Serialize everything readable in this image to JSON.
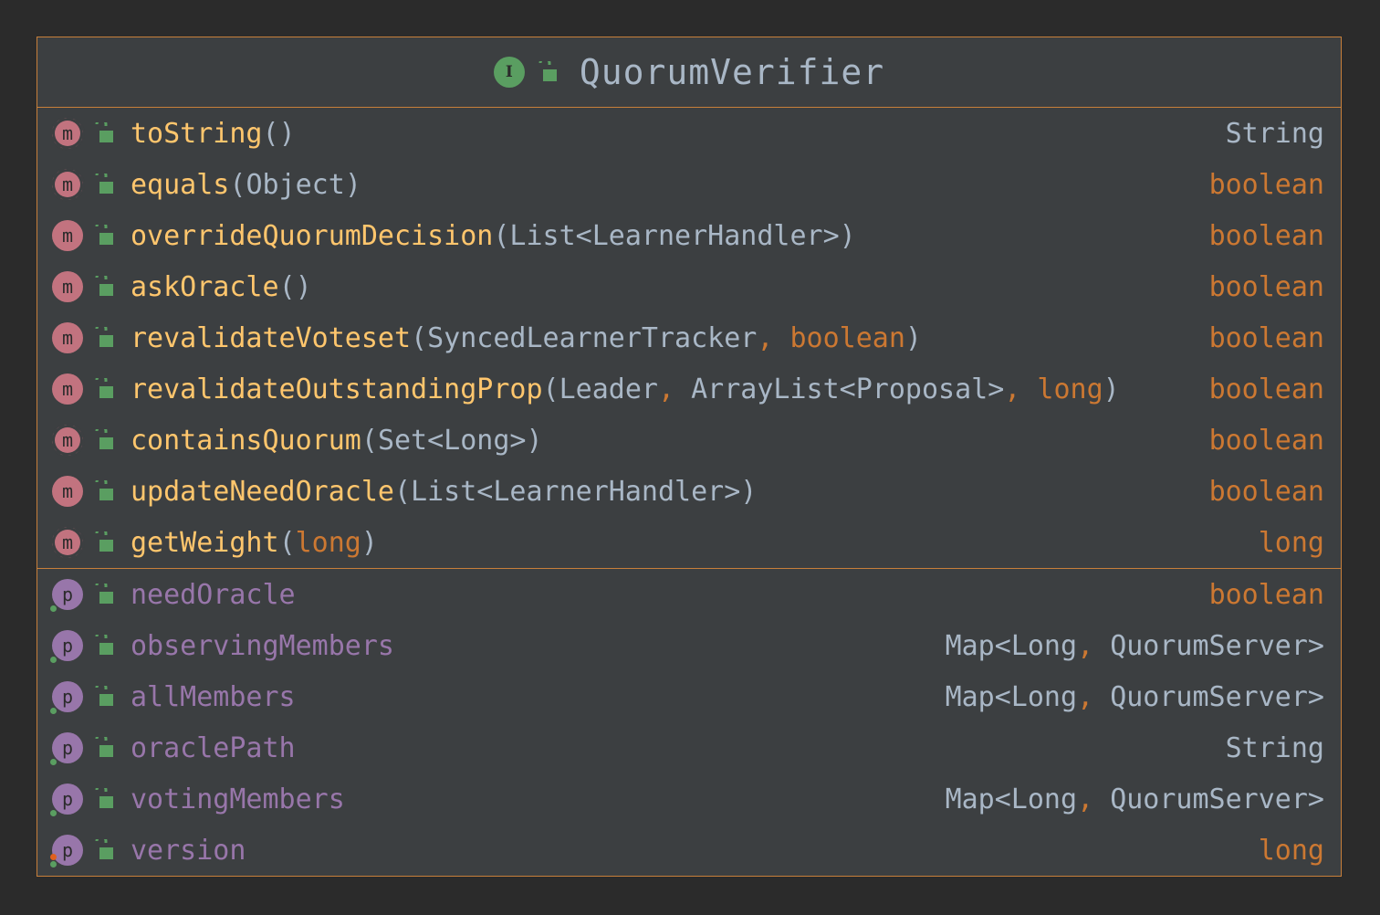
{
  "diagram": {
    "title": "QuorumVerifier",
    "kind_badge": "I",
    "methods": [
      {
        "name": "toString",
        "params": [],
        "return_type": "String",
        "return_is_keyword": false,
        "abstract": false
      },
      {
        "name": "equals",
        "params": [
          {
            "text": "Object",
            "keyword": false
          }
        ],
        "return_type": "boolean",
        "return_is_keyword": true,
        "abstract": false
      },
      {
        "name": "overrideQuorumDecision",
        "params": [
          {
            "text": "List<LearnerHandler>",
            "keyword": false
          }
        ],
        "return_type": "boolean",
        "return_is_keyword": true,
        "abstract": true
      },
      {
        "name": "askOracle",
        "params": [],
        "return_type": "boolean",
        "return_is_keyword": true,
        "abstract": true
      },
      {
        "name": "revalidateVoteset",
        "params": [
          {
            "text": "SyncedLearnerTracker",
            "keyword": false
          },
          {
            "text": "boolean",
            "keyword": true
          }
        ],
        "return_type": "boolean",
        "return_is_keyword": true,
        "abstract": true
      },
      {
        "name": "revalidateOutstandingProp",
        "params": [
          {
            "text": "Leader",
            "keyword": false
          },
          {
            "text": "ArrayList<Proposal>",
            "keyword": false
          },
          {
            "text": "long",
            "keyword": true
          }
        ],
        "return_type": "boolean",
        "return_is_keyword": true,
        "abstract": true
      },
      {
        "name": "containsQuorum",
        "params": [
          {
            "text": "Set<Long>",
            "keyword": false
          }
        ],
        "return_type": "boolean",
        "return_is_keyword": true,
        "abstract": false
      },
      {
        "name": "updateNeedOracle",
        "params": [
          {
            "text": "List<LearnerHandler>",
            "keyword": false
          }
        ],
        "return_type": "boolean",
        "return_is_keyword": true,
        "abstract": true
      },
      {
        "name": "getWeight",
        "params": [
          {
            "text": "long",
            "keyword": true
          }
        ],
        "return_type": "long",
        "return_is_keyword": true,
        "abstract": false
      }
    ],
    "properties": [
      {
        "name": "needOracle",
        "type": "boolean",
        "type_is_keyword": true,
        "setter_marker": false
      },
      {
        "name": "observingMembers",
        "type": "Map<Long, QuorumServer>",
        "type_is_keyword": false,
        "setter_marker": false
      },
      {
        "name": "allMembers",
        "type": "Map<Long, QuorumServer>",
        "type_is_keyword": false,
        "setter_marker": false
      },
      {
        "name": "oraclePath",
        "type": "String",
        "type_is_keyword": false,
        "setter_marker": false
      },
      {
        "name": "votingMembers",
        "type": "Map<Long, QuorumServer>",
        "type_is_keyword": false,
        "setter_marker": false
      },
      {
        "name": "version",
        "type": "long",
        "type_is_keyword": true,
        "setter_marker": true
      }
    ],
    "method_badge": "m",
    "property_badge": "p"
  },
  "colors": {
    "background": "#2b2b2b",
    "panel": "#3c3f41",
    "border": "#c77f3a",
    "method_name": "#ffc66d",
    "keyword": "#cc7832",
    "property_name": "#9876aa",
    "default_text": "#a9b7c6",
    "interface_badge": "#5a9e61",
    "method_badge": "#c2737f"
  },
  "icons": {
    "visibility": "unlocked-padlock-icon",
    "interface": "interface-badge-icon",
    "method": "method-badge-icon",
    "property": "property-badge-icon"
  }
}
